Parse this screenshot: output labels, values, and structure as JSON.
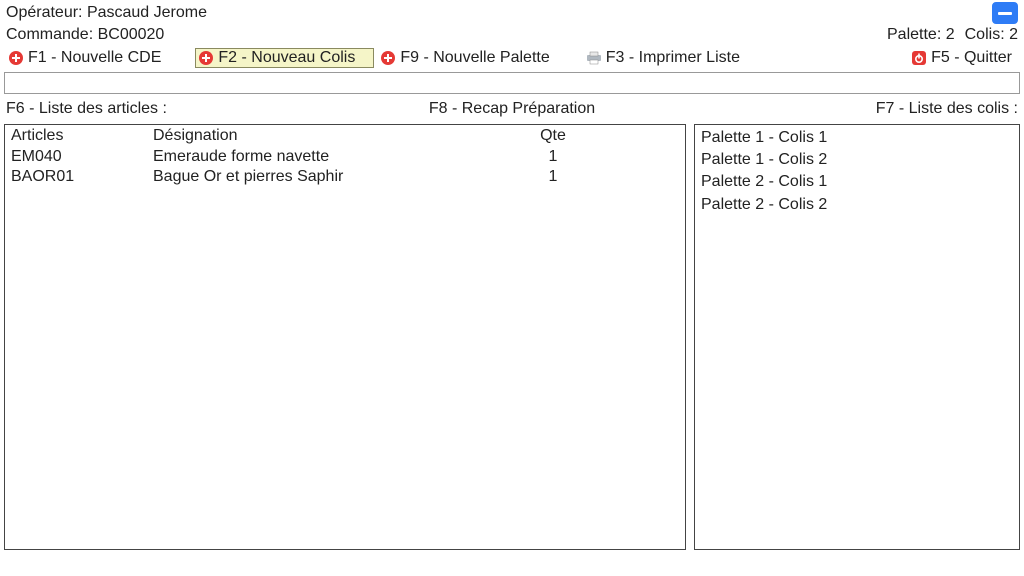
{
  "header": {
    "operator_label": "Opérateur:",
    "operator_name": "Pascaud Jerome",
    "order_label": "Commande:",
    "order_number": "BC00020",
    "palette_label": "Palette:",
    "palette_count": "2",
    "colis_label": "Colis:",
    "colis_count": "2"
  },
  "toolbar": {
    "f1": "F1 - Nouvelle CDE",
    "f2": "F2 - Nouveau Colis",
    "f9": "F9 - Nouvelle Palette",
    "f3": "F3 - Imprimer Liste",
    "f5": "F5 - Quitter"
  },
  "sections": {
    "f6": "F6 - Liste des articles :",
    "f8": "F8 - Recap Préparation",
    "f7": "F7 - Liste des colis :"
  },
  "articles": {
    "headers": {
      "code": "Articles",
      "designation": "Désignation",
      "qte": "Qte"
    },
    "rows": [
      {
        "code": "EM040",
        "designation": "Emeraude forme navette",
        "qte": "1"
      },
      {
        "code": "BAOR01",
        "designation": "Bague Or et pierres Saphir",
        "qte": "1"
      }
    ]
  },
  "colis": [
    "Palette 1 - Colis 1",
    "Palette 1 - Colis 2",
    "Palette 2 - Colis 1",
    "Palette 2 - Colis 2"
  ]
}
